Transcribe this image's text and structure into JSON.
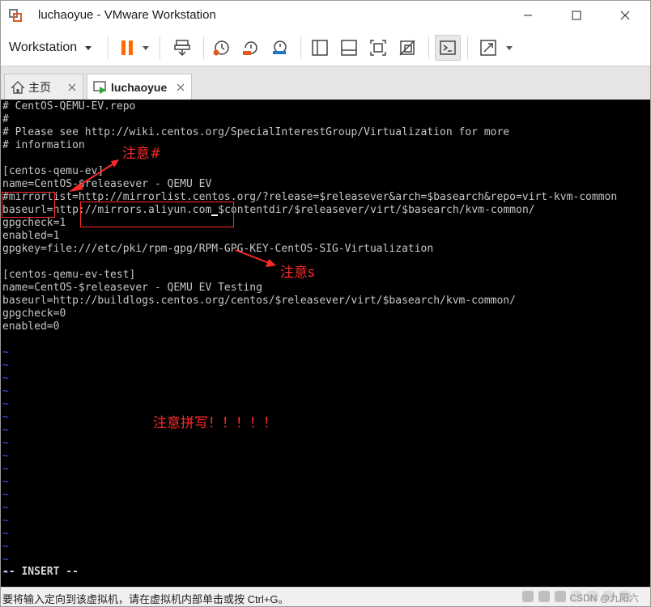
{
  "window": {
    "title": "luchaoyue - VMware Workstation",
    "brand_color": "#e05a1e"
  },
  "toolbar": {
    "menu_label": "Workstation",
    "pause_color": "#ff6a00",
    "icons": [
      "pause-icon",
      "send-keys-icon",
      "snapshot-icon",
      "revert-snapshot-icon",
      "snapshot-manager-icon",
      "show-library-icon",
      "thumbnail-bar-icon",
      "full-screen-icon",
      "unity-icon",
      "console-view-icon",
      "stretch-icon"
    ]
  },
  "tabs": [
    {
      "label": "主页",
      "icon": "home-icon"
    },
    {
      "label": "luchaoyue",
      "icon": "vm-running-icon"
    }
  ],
  "terminal": {
    "lines": [
      "# CentOS-QEMU-EV.repo",
      "#",
      "# Please see http://wiki.centos.org/SpecialInterestGroup/Virtualization for more",
      "# information",
      "",
      "[centos-qemu-ev]",
      "name=CentOS-$releasever - QEMU EV",
      "#mirrorlist=http://mirrorlist.centos.org/?release=$releasever&arch=$basearch&repo=virt-kvm-common",
      "baseurl=http://mirrors.aliyun.com/$contentdir/$releasever/virt/$basearch/kvm-common/",
      "gpgcheck=1",
      "enabled=1",
      "gpgkey=file:///etc/pki/rpm-gpg/RPM-GPG-KEY-CentOS-SIG-Virtualization",
      "",
      "[centos-qemu-ev-test]",
      "name=CentOS-$releasever - QEMU EV Testing",
      "baseurl=http://buildlogs.centos.org/centos/$releasever/virt/$basearch/kvm-common/",
      "gpgcheck=0",
      "enabled=0",
      "",
      "~",
      "~",
      "~",
      "~",
      "~",
      "~",
      "~",
      "~",
      "~",
      "~",
      "~",
      "~",
      "~",
      "~",
      "~",
      "~",
      "~",
      "~"
    ],
    "mode_line": "-- INSERT --",
    "text_color": "#c6c6c6",
    "tilde_color": "#3c54ff"
  },
  "annotations": {
    "note_hash": "注意#",
    "note_s": "注意s",
    "note_spelling": "注意拼写！！！！！",
    "color": "#ff2a2a"
  },
  "status": {
    "message": "要将输入定向到该虚拟机，请在虚拟机内部单击或按 Ctrl+G。",
    "watermark": "CSDN @九阳六"
  }
}
